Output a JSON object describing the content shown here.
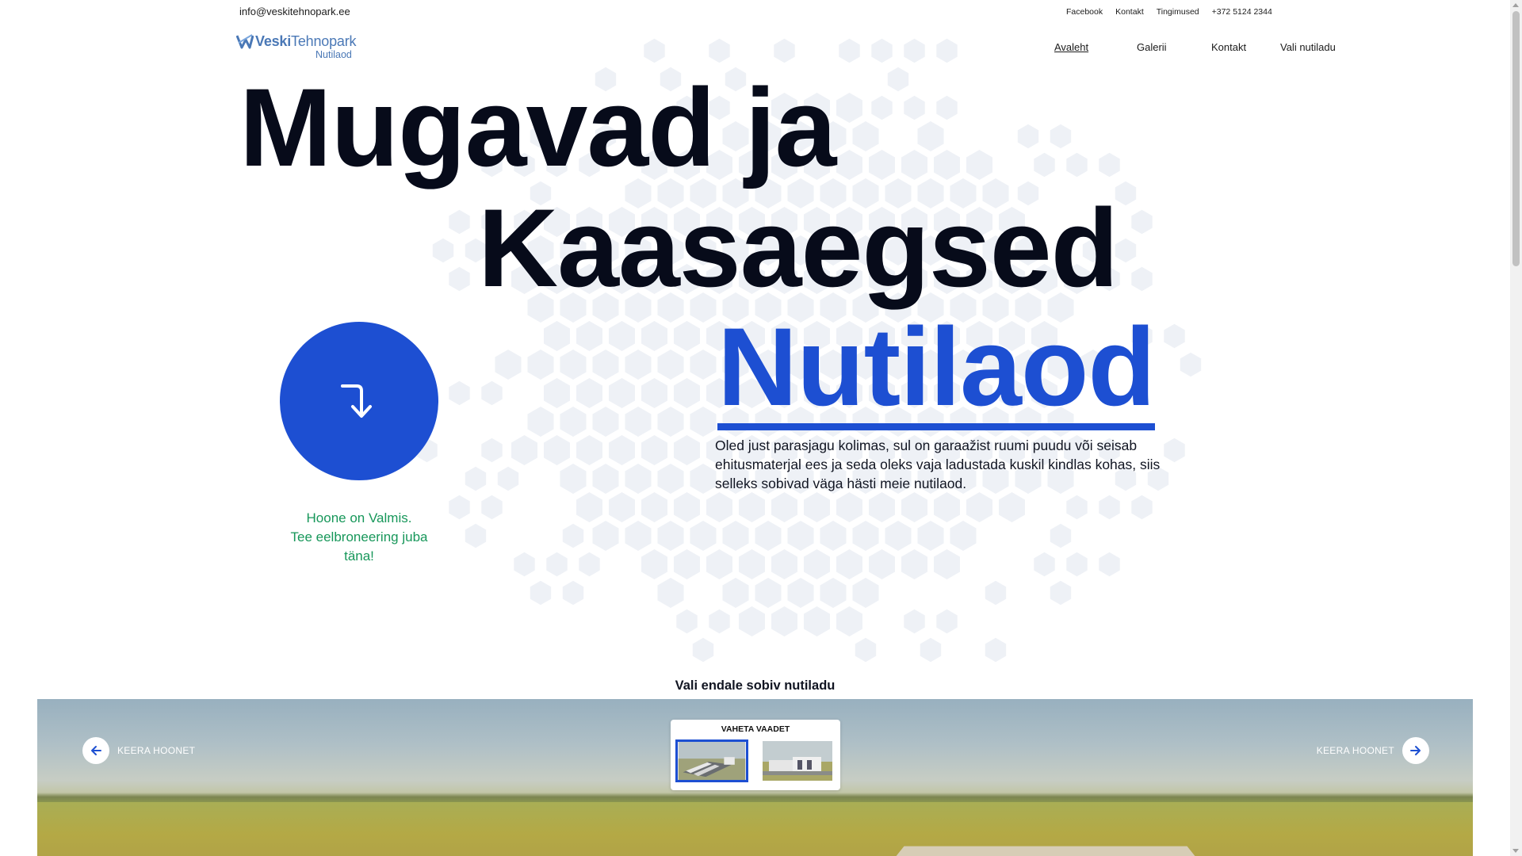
{
  "topbar": {
    "email": "info@veskitehnopark.ee",
    "links": [
      "Facebook",
      "Kontakt",
      "Tingimused",
      "+372 5124 2344"
    ]
  },
  "logo": {
    "brand_bold": "Veski",
    "brand_rest": "Tehnopark",
    "sub": "Nutilaod"
  },
  "nav": {
    "items": [
      {
        "label": "Avaleht",
        "active": true
      },
      {
        "label": "Galerii",
        "active": false
      },
      {
        "label": "Kontakt",
        "active": false
      },
      {
        "label": "Vali nutiladu",
        "active": false
      }
    ]
  },
  "hero": {
    "line1": "Mugavad ja",
    "line2": "Kaasaegsed",
    "line3": "Nutilaod",
    "description": "Oled just parasjagu kolimas, sul on garaažist ruumi puudu või seisab ehitusmaterjal ees ja seda oleks vaja ladustada kuskil kindlas kohas, siis selleks sobivad väga hästi meie nutilaod.",
    "note_lines": [
      "Hoone on Valmis.",
      "Tee eelbroneering juba",
      "täna!"
    ],
    "circle_icon": "arrow-turn-down-icon"
  },
  "viewer": {
    "title": "Vali endale sobiv nutiladu",
    "rotate_left_label": "KEERA HOONET",
    "rotate_right_label": "KEERA HOONET",
    "views_label": "VAHETA VAADET",
    "selected_view": 1
  },
  "colors": {
    "accent": "#1d4fd2",
    "note_green": "#17975a",
    "logo_blue": "#4a78b6",
    "hex_gray": "#eef1f6"
  }
}
